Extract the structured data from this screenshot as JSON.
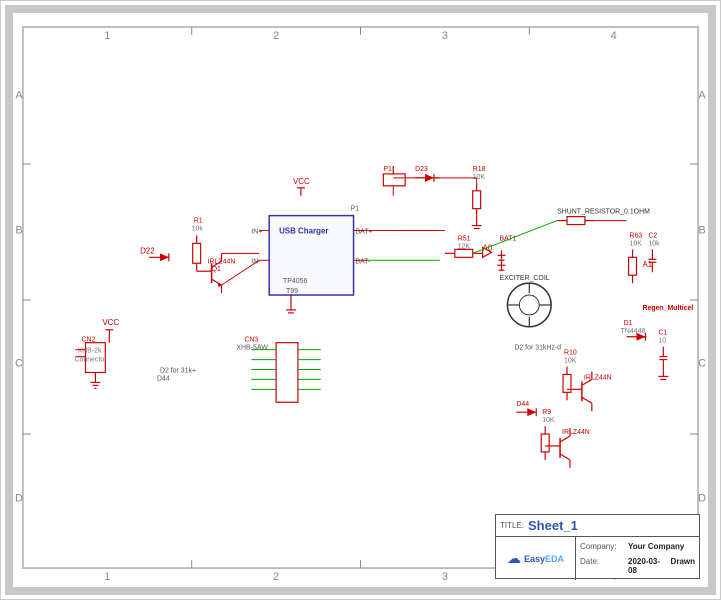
{
  "schematic": {
    "title": "Sheet_1",
    "company": "Your Company",
    "date": "2020-03-08",
    "drawn_by": "Drawn",
    "col_labels": [
      "1",
      "2",
      "3",
      "4"
    ],
    "row_labels": [
      "A",
      "B",
      "C",
      "D"
    ],
    "logo_text": "EasyEDA",
    "title_label": "TITLE:",
    "company_label": "Company:",
    "date_label": "Date:"
  }
}
